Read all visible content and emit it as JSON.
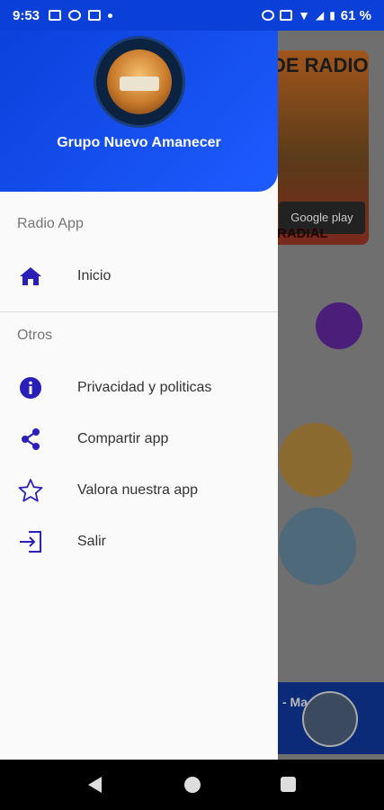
{
  "status_bar": {
    "time": "9:53",
    "battery": "61 %"
  },
  "background": {
    "banner_top": "DE RADIO",
    "banner_store": "Google play",
    "banner_bottom": "RADIAL",
    "player_text": "- Ma"
  },
  "drawer": {
    "app_name": "Grupo Nuevo Amanecer",
    "sections": [
      {
        "label": "Radio App"
      },
      {
        "label": "Otros"
      }
    ],
    "items": [
      {
        "label": "Inicio",
        "icon": "home-icon"
      },
      {
        "label": "Privacidad y politicas",
        "icon": "info-icon"
      },
      {
        "label": "Compartir app",
        "icon": "share-icon"
      },
      {
        "label": "Valora nuestra app",
        "icon": "star-icon"
      },
      {
        "label": "Salir",
        "icon": "exit-icon"
      }
    ]
  },
  "colors": {
    "header": "#0a3fd8",
    "icon": "#2a20b8"
  }
}
